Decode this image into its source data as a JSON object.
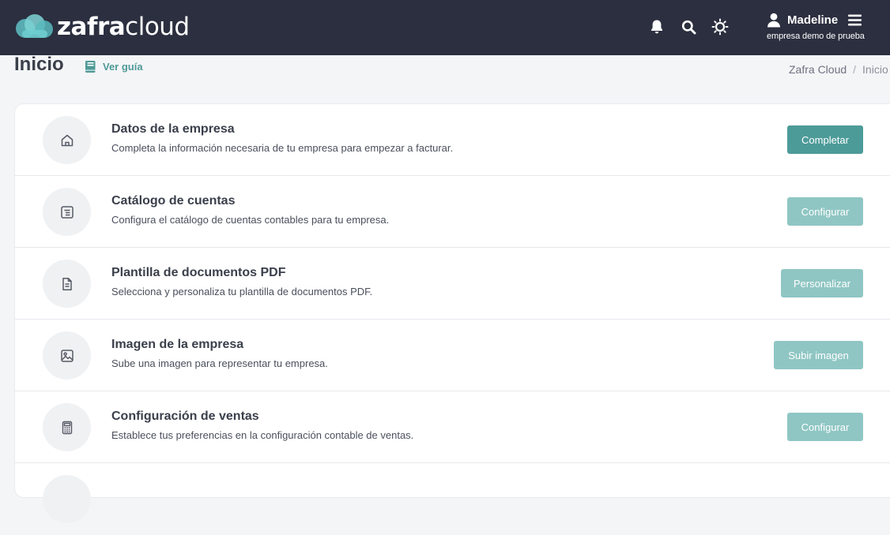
{
  "header": {
    "logo": {
      "part1": "zafra",
      "part2": "cloud"
    },
    "icons": [
      "bell-icon",
      "search-icon",
      "sun-icon",
      "user-icon",
      "hamburger-menu-icon"
    ],
    "user_name": "Madeline",
    "company": "empresa demo de prueba"
  },
  "page": {
    "title": "Inicio",
    "guide_label": "Ver guía",
    "breadcrumb": [
      "Zafra Cloud",
      "Inicio"
    ]
  },
  "setup_items": [
    {
      "icon": "home-icon",
      "title": "Datos de la empresa",
      "description": "Completa la información necesaria de tu empresa para empezar a facturar.",
      "button": "Completar",
      "button_style": "primary"
    },
    {
      "icon": "list-icon",
      "title": "Catálogo de cuentas",
      "description": "Configura el catálogo de cuentas contables para tu empresa.",
      "button": "Configurar",
      "button_style": "light"
    },
    {
      "icon": "document-icon",
      "title": "Plantilla de documentos PDF",
      "description": "Selecciona y personaliza tu plantilla de documentos PDF.",
      "button": "Personalizar",
      "button_style": "light"
    },
    {
      "icon": "image-icon",
      "title": "Imagen de la empresa",
      "description": "Sube una imagen para representar tu empresa.",
      "button": "Subir imagen",
      "button_style": "light"
    },
    {
      "icon": "calculator-icon",
      "title": "Configuración de ventas",
      "description": "Establece tus preferencias en la configuración contable de ventas.",
      "button": "Configurar",
      "button_style": "light"
    }
  ],
  "colors": {
    "header_bg": "#2b2f3f",
    "accent": "#4c9b99",
    "accent_light": "#8fc6c3",
    "logo_cloud": "#6ecdd0"
  }
}
